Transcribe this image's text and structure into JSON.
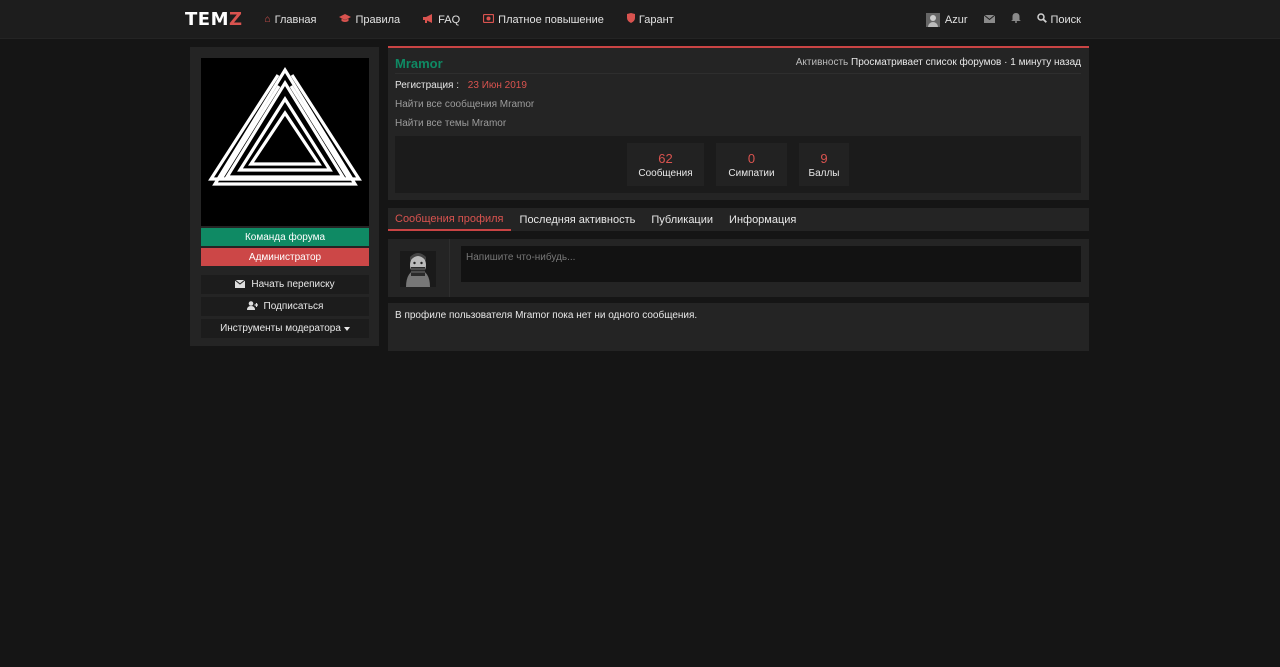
{
  "header": {
    "logo": "TEM",
    "logo_accent": "Z",
    "nav": [
      {
        "label": "Главная",
        "icon": "home-icon"
      },
      {
        "label": "Правила",
        "icon": "graduation-cap-icon"
      },
      {
        "label": "FAQ",
        "icon": "bullhorn-icon"
      },
      {
        "label": "Платное повышение",
        "icon": "video-icon"
      },
      {
        "label": "Гарант",
        "icon": "shield-icon"
      }
    ],
    "user_name": "Azur",
    "search_label": "Поиск"
  },
  "sidebar": {
    "badge_team": "Команда форума",
    "badge_admin": "Администратор",
    "start_conversation": "Начать переписку",
    "follow": "Подписаться",
    "mod_tools": "Инструменты модератора"
  },
  "profile": {
    "username": "Mramor",
    "activity_label": "Активность",
    "activity_value": "Просматривает список форумов · 1 минуту назад",
    "registration_label": "Регистрация :",
    "registration_date": "23 Июн 2019",
    "find_posts": "Найти все сообщения Mramor",
    "find_threads": "Найти все темы Mramor",
    "stats": [
      {
        "value": "62",
        "label": "Сообщения"
      },
      {
        "value": "0",
        "label": "Симпатии"
      },
      {
        "value": "9",
        "label": "Баллы"
      }
    ]
  },
  "tabs": [
    {
      "label": "Сообщения профиля",
      "active": true
    },
    {
      "label": "Последняя активность",
      "active": false
    },
    {
      "label": "Публикации",
      "active": false
    },
    {
      "label": "Информация",
      "active": false
    }
  ],
  "post_form": {
    "placeholder": "Напишите что-нибудь..."
  },
  "empty_message": "В профиле пользователя Mramor пока нет ни одного сообщения.",
  "colors": {
    "accent": "#d9534f",
    "team_green": "#0f8a64",
    "admin_red": "#cc4747",
    "background": "#151515",
    "panel": "#242424"
  }
}
